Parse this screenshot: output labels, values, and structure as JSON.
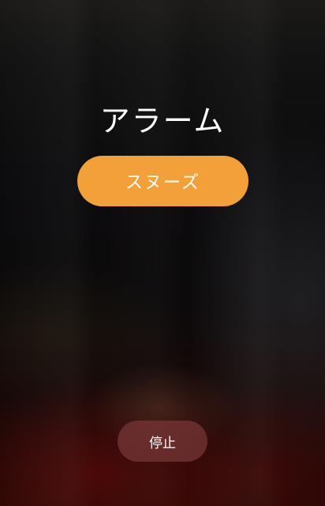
{
  "alarm": {
    "title": "アラーム",
    "snooze_label": "スヌーズ",
    "stop_label": "停止"
  },
  "colors": {
    "snooze_button": "#f2a03a",
    "stop_button": "#783737",
    "text": "#ffffff"
  }
}
